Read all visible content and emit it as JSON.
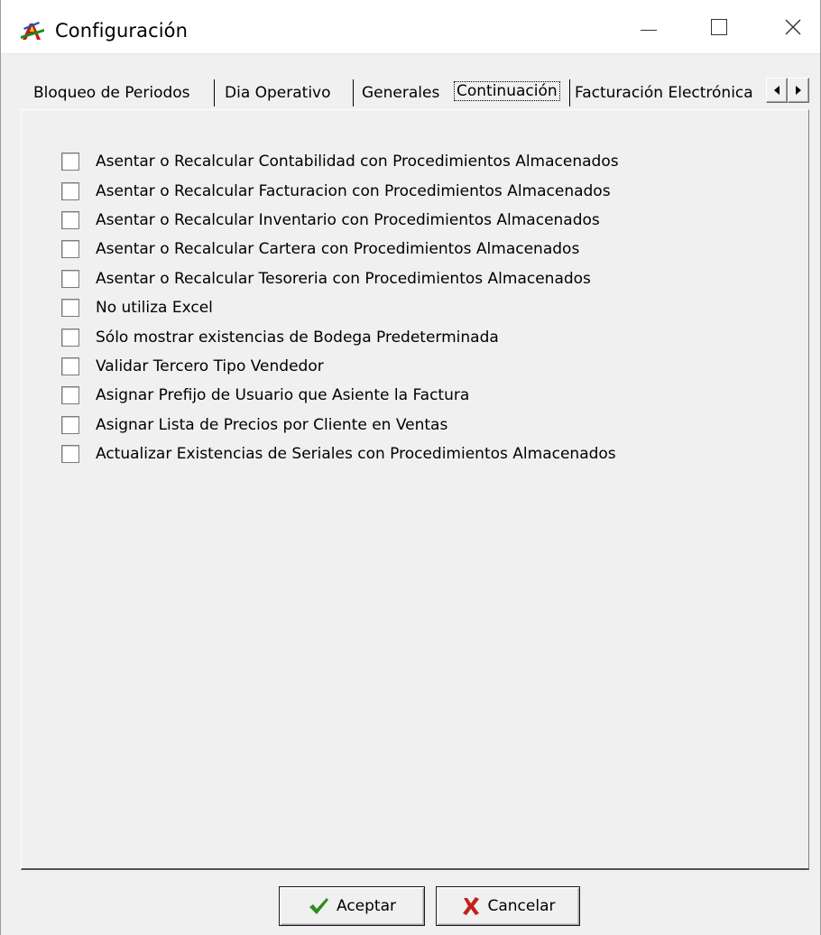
{
  "window": {
    "title": "Configuración",
    "icon": "app-logo-icon"
  },
  "title_controls": {
    "minimize_icon": "minimize-icon",
    "maximize_icon": "maximize-icon",
    "close_icon": "close-icon",
    "close_glyph": "✕"
  },
  "tabs": [
    {
      "label": "Bloqueo de Periodos",
      "active": false
    },
    {
      "label": "Dia Operativo",
      "active": false
    },
    {
      "label": "Generales",
      "active": false
    },
    {
      "label": "Continuación",
      "active": true
    },
    {
      "label": "Facturación Electrónica",
      "active": false
    }
  ],
  "tab_scroll": {
    "left_icon": "arrow-left-icon",
    "right_icon": "arrow-right-icon"
  },
  "options": [
    {
      "label": "Asentar o Recalcular Contabilidad con Procedimientos Almacenados",
      "checked": false
    },
    {
      "label": "Asentar o Recalcular Facturacion con Procedimientos Almacenados",
      "checked": false
    },
    {
      "label": "Asentar o Recalcular Inventario con Procedimientos Almacenados",
      "checked": false
    },
    {
      "label": "Asentar o Recalcular Cartera con Procedimientos Almacenados",
      "checked": false
    },
    {
      "label": "Asentar o Recalcular Tesoreria con Procedimientos Almacenados",
      "checked": false
    },
    {
      "label": "No utiliza Excel",
      "checked": false
    },
    {
      "label": "Sólo mostrar existencias de Bodega Predeterminada",
      "checked": false
    },
    {
      "label": "Validar Tercero Tipo Vendedor",
      "checked": false
    },
    {
      "label": "Asignar Prefijo de Usuario que Asiente la Factura",
      "checked": false
    },
    {
      "label": "Asignar Lista de Precios por Cliente en Ventas",
      "checked": false
    },
    {
      "label": "Actualizar Existencias de Seriales con Procedimientos Almacenados",
      "checked": false
    }
  ],
  "buttons": {
    "accept": {
      "label": "Aceptar",
      "icon": "checkmark-icon",
      "color": "#2e8b1e"
    },
    "cancel": {
      "label": "Cancelar",
      "icon": "x-mark-icon",
      "color": "#c0211a"
    }
  }
}
